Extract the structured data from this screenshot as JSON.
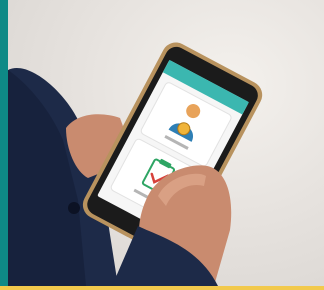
{
  "photo": {
    "description_icons": [
      "person-with-coin-icon",
      "clipboard-check-icon"
    ],
    "colors": {
      "frame_teal": "#0e8a86",
      "app_teal": "#3bb7b0",
      "suit_navy": "#1d2a48",
      "highlight_yellow": "#f2c94c"
    }
  },
  "screen": {
    "card_top_caption": "",
    "card_bottom_caption": ""
  }
}
